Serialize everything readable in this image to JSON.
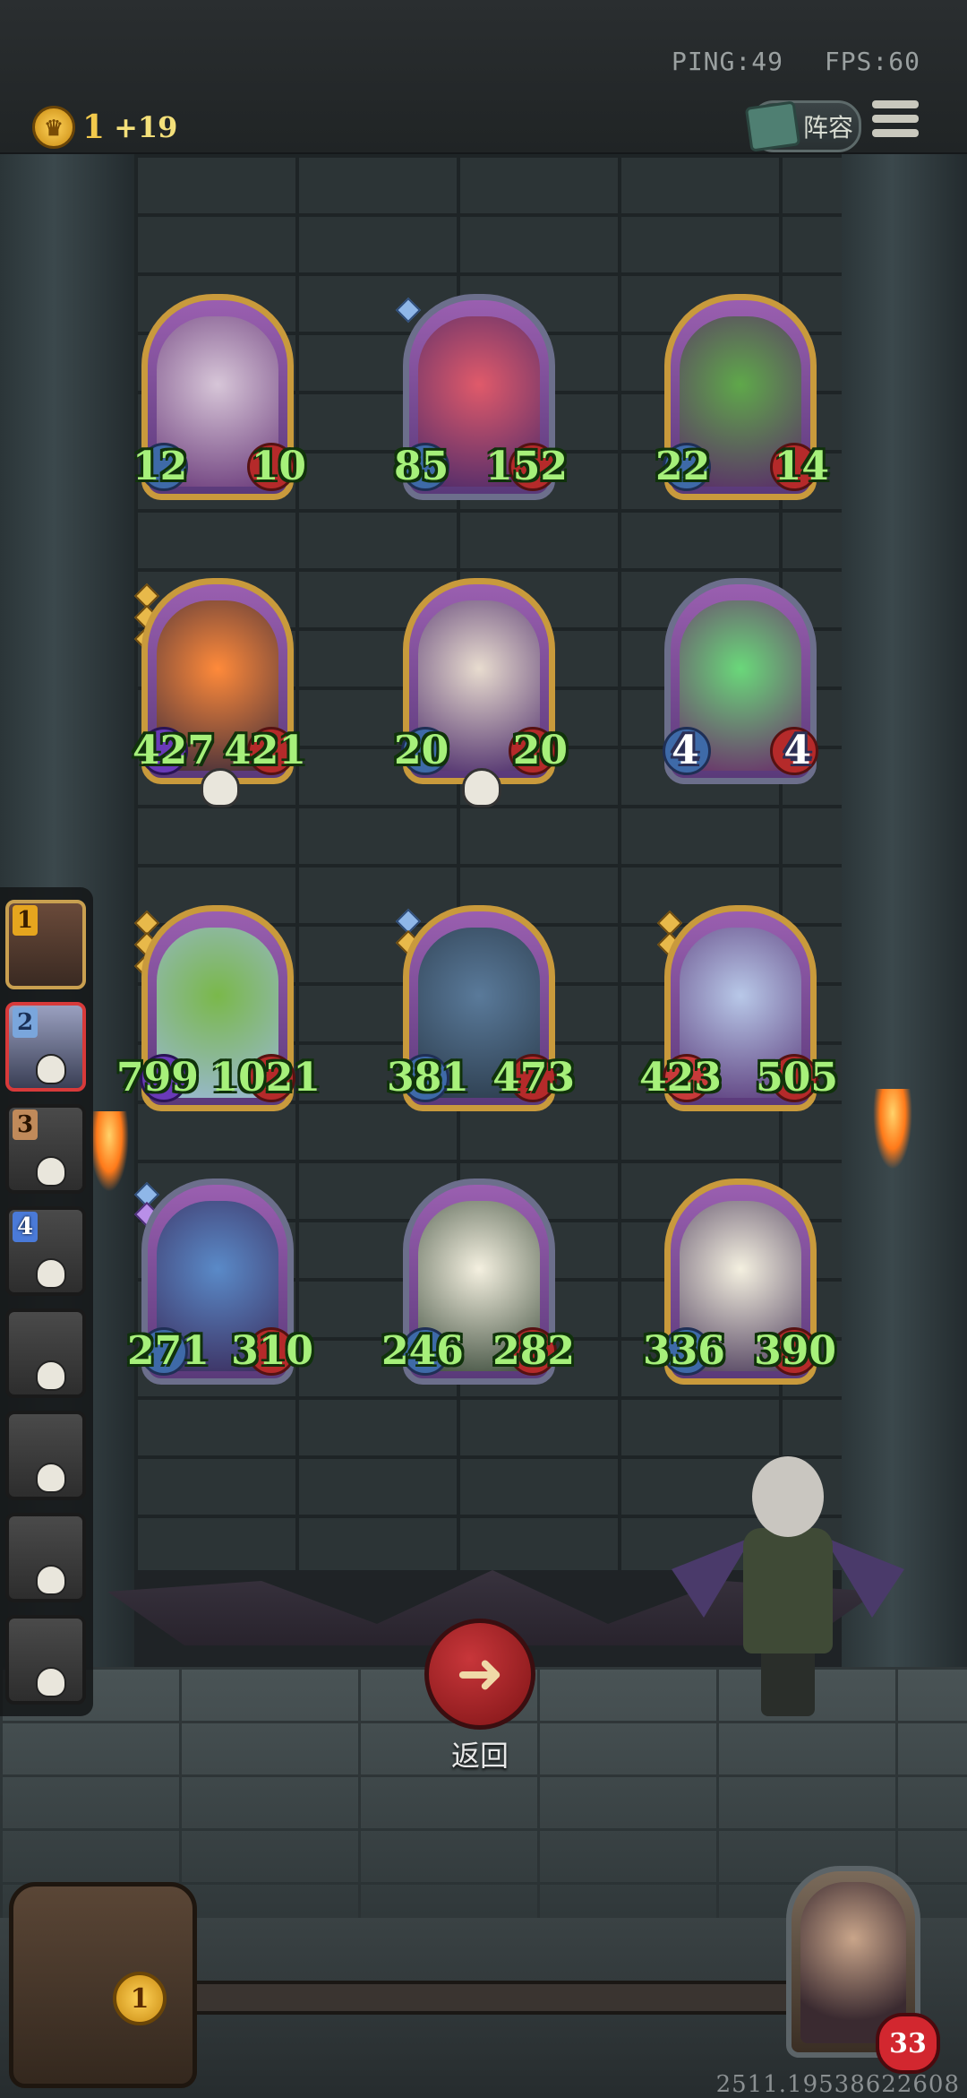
{
  "status": {
    "ping": "PING:49",
    "fps": "FPS:60"
  },
  "resources": {
    "gold": "1",
    "gold_income": "+19"
  },
  "header": {
    "lineup_label": "阵容"
  },
  "board": {
    "units": [
      {
        "attack": "12",
        "health": "10"
      },
      {
        "attack": "85",
        "health": "152"
      },
      {
        "attack": "22",
        "health": "14"
      },
      {
        "attack": "427",
        "health": "421"
      },
      {
        "attack": "20",
        "health": "20"
      },
      {
        "attack": "4",
        "health": "4"
      },
      {
        "attack": "799",
        "health": "1021"
      },
      {
        "attack": "381",
        "health": "473"
      },
      {
        "attack": "423",
        "health": "505"
      },
      {
        "attack": "271",
        "health": "310"
      },
      {
        "attack": "246",
        "health": "282"
      },
      {
        "attack": "336",
        "health": "390"
      }
    ]
  },
  "team_list": {
    "slots": [
      {
        "number": "1"
      },
      {
        "number": "2"
      },
      {
        "number": "3"
      },
      {
        "number": "4"
      },
      {
        "number": ""
      },
      {
        "number": ""
      },
      {
        "number": ""
      },
      {
        "number": ""
      }
    ]
  },
  "actions": {
    "back_label": "返回"
  },
  "footer": {
    "chest_count": "1",
    "player_health": "33",
    "player_id": "2511.19538622608"
  }
}
